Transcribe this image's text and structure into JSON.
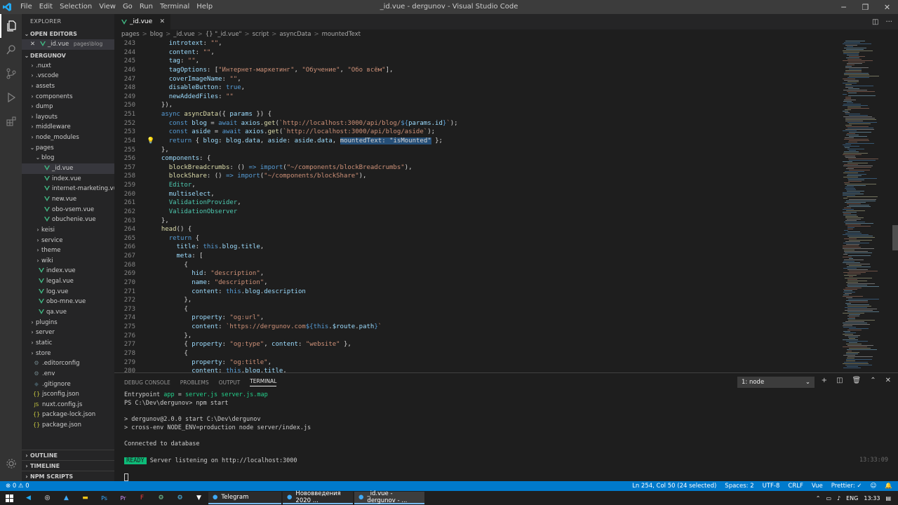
{
  "titlebar": {
    "menu": [
      "File",
      "Edit",
      "Selection",
      "View",
      "Go",
      "Run",
      "Terminal",
      "Help"
    ],
    "title": "_id.vue - dergunov - Visual Studio Code",
    "controls": [
      "─",
      "❐",
      "✕"
    ]
  },
  "sidebar": {
    "header": "EXPLORER",
    "open_editors_label": "OPEN EDITORS",
    "open_editor": {
      "name": "_id.vue",
      "path": "pages\\blog"
    },
    "project_label": "DERGUNOV",
    "tree": [
      {
        "label": ".nuxt",
        "type": "folder",
        "depth": 0
      },
      {
        "label": ".vscode",
        "type": "folder",
        "depth": 0
      },
      {
        "label": "assets",
        "type": "folder",
        "depth": 0
      },
      {
        "label": "components",
        "type": "folder",
        "depth": 0
      },
      {
        "label": "dump",
        "type": "folder",
        "depth": 0
      },
      {
        "label": "layouts",
        "type": "folder",
        "depth": 0
      },
      {
        "label": "middleware",
        "type": "folder",
        "depth": 0
      },
      {
        "label": "node_modules",
        "type": "folder",
        "depth": 0
      },
      {
        "label": "pages",
        "type": "folder-open",
        "depth": 0
      },
      {
        "label": "blog",
        "type": "folder-open",
        "depth": 1
      },
      {
        "label": "_id.vue",
        "type": "vue",
        "depth": 2,
        "selected": true
      },
      {
        "label": "index.vue",
        "type": "vue",
        "depth": 2
      },
      {
        "label": "internet-marketing.vue",
        "type": "vue",
        "depth": 2
      },
      {
        "label": "new.vue",
        "type": "vue",
        "depth": 2
      },
      {
        "label": "obo-vsem.vue",
        "type": "vue",
        "depth": 2
      },
      {
        "label": "obuchenie.vue",
        "type": "vue",
        "depth": 2
      },
      {
        "label": "keisi",
        "type": "folder",
        "depth": 1
      },
      {
        "label": "service",
        "type": "folder",
        "depth": 1
      },
      {
        "label": "theme",
        "type": "folder",
        "depth": 1
      },
      {
        "label": "wiki",
        "type": "folder",
        "depth": 1
      },
      {
        "label": "index.vue",
        "type": "vue",
        "depth": 1
      },
      {
        "label": "legal.vue",
        "type": "vue",
        "depth": 1
      },
      {
        "label": "log.vue",
        "type": "vue",
        "depth": 1
      },
      {
        "label": "obo-mne.vue",
        "type": "vue",
        "depth": 1
      },
      {
        "label": "qa.vue",
        "type": "vue",
        "depth": 1
      },
      {
        "label": "plugins",
        "type": "folder",
        "depth": 0
      },
      {
        "label": "server",
        "type": "folder",
        "depth": 0
      },
      {
        "label": "static",
        "type": "folder",
        "depth": 0
      },
      {
        "label": "store",
        "type": "folder",
        "depth": 0
      },
      {
        "label": ".editorconfig",
        "type": "gear",
        "depth": 0
      },
      {
        "label": ".env",
        "type": "gear",
        "depth": 0
      },
      {
        "label": ".gitignore",
        "type": "diamond",
        "depth": 0
      },
      {
        "label": "jsconfig.json",
        "type": "json",
        "depth": 0
      },
      {
        "label": "nuxt.config.js",
        "type": "js",
        "depth": 0
      },
      {
        "label": "package-lock.json",
        "type": "json",
        "depth": 0
      },
      {
        "label": "package.json",
        "type": "json",
        "depth": 0
      }
    ],
    "bottom_sections": [
      "OUTLINE",
      "TIMELINE",
      "NPM SCRIPTS"
    ]
  },
  "editor": {
    "tab": "_id.vue",
    "breadcrumb": [
      "pages",
      ">",
      "blog",
      ">",
      "_id.vue",
      ">",
      "{} \"_id.vue\"",
      ">",
      "script",
      ">",
      "asyncData",
      ">",
      "mountedText"
    ],
    "lines": [
      {
        "n": "243",
        "indent": 4,
        "tokens": [
          [
            "pr",
            "introtext"
          ],
          [
            "",
            "​: "
          ],
          [
            "st",
            "\"\""
          ],
          [
            "",
            ","
          ]
        ]
      },
      {
        "n": "244",
        "indent": 4,
        "tokens": [
          [
            "pr",
            "content"
          ],
          [
            "",
            ": "
          ],
          [
            "st",
            "\"\""
          ],
          [
            "",
            ","
          ]
        ]
      },
      {
        "n": "245",
        "indent": 4,
        "tokens": [
          [
            "pr",
            "tag"
          ],
          [
            "",
            ": "
          ],
          [
            "st",
            "\"\""
          ],
          [
            "",
            ","
          ]
        ]
      },
      {
        "n": "246",
        "indent": 4,
        "tokens": [
          [
            "pr",
            "tagOptions"
          ],
          [
            "",
            ": ["
          ],
          [
            "st",
            "\"Интернет-маркетинг\""
          ],
          [
            "",
            ", "
          ],
          [
            "st",
            "\"Обучение\""
          ],
          [
            "",
            ", "
          ],
          [
            "st",
            "\"Обо всём\""
          ],
          [
            "",
            "],"
          ]
        ]
      },
      {
        "n": "247",
        "indent": 4,
        "tokens": [
          [
            "pr",
            "coverImageName"
          ],
          [
            "",
            ": "
          ],
          [
            "st",
            "\"\""
          ],
          [
            "",
            ","
          ]
        ]
      },
      {
        "n": "248",
        "indent": 4,
        "tokens": [
          [
            "pr",
            "disableButton"
          ],
          [
            "",
            ": "
          ],
          [
            "kw",
            "true"
          ],
          [
            "",
            ","
          ]
        ]
      },
      {
        "n": "249",
        "indent": 4,
        "tokens": [
          [
            "pr",
            "newAddedFiles"
          ],
          [
            "",
            ": "
          ],
          [
            "st",
            "\"\""
          ]
        ]
      },
      {
        "n": "250",
        "indent": 2,
        "tokens": [
          [
            "",
            "}),"
          ]
        ]
      },
      {
        "n": "251",
        "indent": 2,
        "tokens": [
          [
            "kw",
            "async "
          ],
          [
            "fn",
            "asyncData"
          ],
          [
            "",
            "({ "
          ],
          [
            "vr",
            "params"
          ],
          [
            "",
            " }) {"
          ]
        ]
      },
      {
        "n": "252",
        "indent": 4,
        "tokens": [
          [
            "kw",
            "const "
          ],
          [
            "vr",
            "blog"
          ],
          [
            "",
            " = "
          ],
          [
            "kw",
            "await "
          ],
          [
            "vr",
            "axios"
          ],
          [
            "",
            "."
          ],
          [
            "fn",
            "get"
          ],
          [
            "",
            "("
          ],
          [
            "st",
            "`http://localhost:3000/api/blog/"
          ],
          [
            "kw",
            "${"
          ],
          [
            "vr",
            "params.id"
          ],
          [
            "kw",
            "}"
          ],
          [
            "st",
            "`"
          ],
          [
            "",
            ");"
          ]
        ]
      },
      {
        "n": "253",
        "indent": 4,
        "tokens": [
          [
            "kw",
            "const "
          ],
          [
            "vr",
            "aside"
          ],
          [
            "",
            " = "
          ],
          [
            "kw",
            "await "
          ],
          [
            "vr",
            "axios"
          ],
          [
            "",
            "."
          ],
          [
            "fn",
            "get"
          ],
          [
            "",
            "("
          ],
          [
            "st",
            "`http://localhost:3000/api/blog/aside`"
          ],
          [
            "",
            ");"
          ]
        ]
      },
      {
        "n": "254",
        "indent": 4,
        "bulb": true,
        "tokens": [
          [
            "kw",
            "return "
          ],
          [
            "",
            "{ "
          ],
          [
            "pr",
            "blog"
          ],
          [
            "",
            ": "
          ],
          [
            "vr",
            "blog"
          ],
          [
            "",
            "."
          ],
          [
            "pr",
            "data"
          ],
          [
            "",
            ", "
          ],
          [
            "pr",
            "aside"
          ],
          [
            "",
            ": "
          ],
          [
            "vr",
            "aside"
          ],
          [
            "",
            "."
          ],
          [
            "pr",
            "data"
          ],
          [
            "",
            ", "
          ],
          [
            "hl",
            "mountedText: \"isMounted\""
          ],
          [
            "",
            " };"
          ]
        ]
      },
      {
        "n": "255",
        "indent": 2,
        "tokens": [
          [
            "",
            "},"
          ]
        ]
      },
      {
        "n": "256",
        "indent": 2,
        "tokens": [
          [
            "pr",
            "components"
          ],
          [
            "",
            ": {"
          ]
        ]
      },
      {
        "n": "257",
        "indent": 4,
        "tokens": [
          [
            "fn",
            "blockBreadcrumbs"
          ],
          [
            "",
            ": () "
          ],
          [
            "kw",
            "=>"
          ],
          [
            "",
            " "
          ],
          [
            "kw",
            "import"
          ],
          [
            "",
            "("
          ],
          [
            "st",
            "\"~/components/blockBreadcrumbs\""
          ],
          [
            "",
            "),"
          ]
        ]
      },
      {
        "n": "258",
        "indent": 4,
        "tokens": [
          [
            "fn",
            "blockShare"
          ],
          [
            "",
            ": () "
          ],
          [
            "kw",
            "=>"
          ],
          [
            "",
            " "
          ],
          [
            "kw",
            "import"
          ],
          [
            "",
            "("
          ],
          [
            "st",
            "\"~/components/blockShare\""
          ],
          [
            "",
            "),"
          ]
        ]
      },
      {
        "n": "259",
        "indent": 4,
        "tokens": [
          [
            "cls",
            "Editor"
          ],
          [
            "",
            ","
          ]
        ]
      },
      {
        "n": "260",
        "indent": 4,
        "tokens": [
          [
            "vr",
            "multiselect"
          ],
          [
            "",
            ","
          ]
        ]
      },
      {
        "n": "261",
        "indent": 4,
        "tokens": [
          [
            "cls",
            "ValidationProvider"
          ],
          [
            "",
            ","
          ]
        ]
      },
      {
        "n": "262",
        "indent": 4,
        "tokens": [
          [
            "cls",
            "ValidationObserver"
          ]
        ]
      },
      {
        "n": "263",
        "indent": 2,
        "tokens": [
          [
            "",
            "},"
          ]
        ]
      },
      {
        "n": "264",
        "indent": 2,
        "tokens": [
          [
            "fn",
            "head"
          ],
          [
            "",
            "() {"
          ]
        ]
      },
      {
        "n": "265",
        "indent": 4,
        "tokens": [
          [
            "kw",
            "return "
          ],
          [
            "",
            "{"
          ]
        ]
      },
      {
        "n": "266",
        "indent": 6,
        "tokens": [
          [
            "pr",
            "title"
          ],
          [
            "",
            ": "
          ],
          [
            "kw",
            "this"
          ],
          [
            "",
            "."
          ],
          [
            "pr",
            "blog"
          ],
          [
            "",
            "."
          ],
          [
            "pr",
            "title"
          ],
          [
            "",
            ","
          ]
        ]
      },
      {
        "n": "267",
        "indent": 6,
        "tokens": [
          [
            "pr",
            "meta"
          ],
          [
            "",
            ": ["
          ]
        ]
      },
      {
        "n": "268",
        "indent": 8,
        "tokens": [
          [
            "",
            "{"
          ]
        ]
      },
      {
        "n": "269",
        "indent": 10,
        "tokens": [
          [
            "pr",
            "hid"
          ],
          [
            "",
            ": "
          ],
          [
            "st",
            "\"description\""
          ],
          [
            "",
            ","
          ]
        ]
      },
      {
        "n": "270",
        "indent": 10,
        "tokens": [
          [
            "pr",
            "name"
          ],
          [
            "",
            ": "
          ],
          [
            "st",
            "\"description\""
          ],
          [
            "",
            ","
          ]
        ]
      },
      {
        "n": "271",
        "indent": 10,
        "tokens": [
          [
            "pr",
            "content"
          ],
          [
            "",
            ": "
          ],
          [
            "kw",
            "this"
          ],
          [
            "",
            "."
          ],
          [
            "pr",
            "blog"
          ],
          [
            "",
            "."
          ],
          [
            "pr",
            "description"
          ]
        ]
      },
      {
        "n": "272",
        "indent": 8,
        "tokens": [
          [
            "",
            "},"
          ]
        ]
      },
      {
        "n": "273",
        "indent": 8,
        "tokens": [
          [
            "",
            "{"
          ]
        ]
      },
      {
        "n": "274",
        "indent": 10,
        "tokens": [
          [
            "pr",
            "property"
          ],
          [
            "",
            ": "
          ],
          [
            "st",
            "\"og:url\""
          ],
          [
            "",
            ","
          ]
        ]
      },
      {
        "n": "275",
        "indent": 10,
        "tokens": [
          [
            "pr",
            "content"
          ],
          [
            "",
            ": "
          ],
          [
            "st",
            "`https://dergunov.com"
          ],
          [
            "kw",
            "${"
          ],
          [
            "kw",
            "this"
          ],
          [
            "",
            "."
          ],
          [
            "vr",
            "$route"
          ],
          [
            "",
            "."
          ],
          [
            "pr",
            "path"
          ],
          [
            "kw",
            "}"
          ],
          [
            "st",
            "`"
          ]
        ]
      },
      {
        "n": "276",
        "indent": 8,
        "tokens": [
          [
            "",
            "},"
          ]
        ]
      },
      {
        "n": "277",
        "indent": 8,
        "tokens": [
          [
            "",
            "{ "
          ],
          [
            "pr",
            "property"
          ],
          [
            "",
            ": "
          ],
          [
            "st",
            "\"og:type\""
          ],
          [
            "",
            ", "
          ],
          [
            "pr",
            "content"
          ],
          [
            "",
            ": "
          ],
          [
            "st",
            "\"website\""
          ],
          [
            "",
            " },"
          ]
        ]
      },
      {
        "n": "278",
        "indent": 8,
        "tokens": [
          [
            "",
            "{"
          ]
        ]
      },
      {
        "n": "279",
        "indent": 10,
        "tokens": [
          [
            "pr",
            "property"
          ],
          [
            "",
            ": "
          ],
          [
            "st",
            "\"og:title\""
          ],
          [
            "",
            ","
          ]
        ]
      },
      {
        "n": "280",
        "indent": 10,
        "tokens": [
          [
            "pr",
            "content"
          ],
          [
            "",
            ": "
          ],
          [
            "kw",
            "this"
          ],
          [
            "",
            "."
          ],
          [
            "pr",
            "blog"
          ],
          [
            "",
            "."
          ],
          [
            "pr",
            "title"
          ],
          [
            "",
            ","
          ]
        ]
      }
    ]
  },
  "panel": {
    "tabs": [
      "DEBUG CONSOLE",
      "PROBLEMS",
      "OUTPUT",
      "TERMINAL"
    ],
    "active_tab": "TERMINAL",
    "terminal_select": "1: node",
    "terminal": {
      "l1_a": "Entrypoint ",
      "l1_b": "app",
      "l1_c": " = ",
      "l1_d": "server.js",
      "l1_e": " ",
      "l1_f": "server.js.map",
      "l2": "PS C:\\Dev\\dergunov> npm start",
      "l3": "",
      "l4": "> dergunov@2.0.0 start C:\\Dev\\dergunov",
      "l5": "> cross-env NODE_ENV=production node server/index.js",
      "l6": "",
      "l7": "Connected to database",
      "l8": "",
      "ready": "READY",
      "l9": " Server listening on http://localhost:3000",
      "time": "13:33:09"
    }
  },
  "statusbar": {
    "left": "⊗ 0 ⚠ 0",
    "items": [
      "Ln 254, Col 50 (24 selected)",
      "Spaces: 2",
      "UTF-8",
      "CRLF",
      "Vue",
      "Prettier: ✓",
      "☺",
      "🔔"
    ]
  },
  "taskbar": {
    "apps": [
      {
        "label": "Telegram",
        "current": false
      },
      {
        "label": "Нововведения 2020 ...",
        "current": false
      },
      {
        "label": "_id.vue - dergunov - ...",
        "current": true
      }
    ],
    "tray_lang": "ENG",
    "tray_time": "13:33"
  },
  "colors": {
    "accent": "#007acc",
    "vue": "#41b883"
  }
}
